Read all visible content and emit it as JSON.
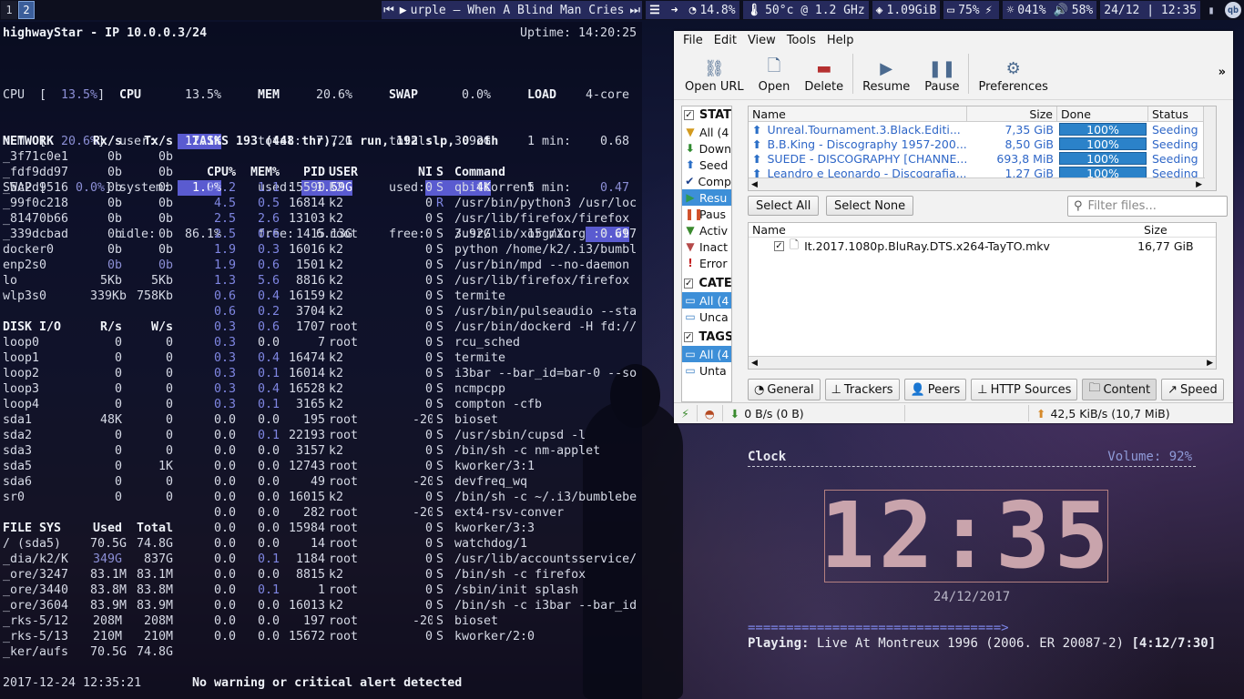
{
  "topbar": {
    "workspaces": [
      "1",
      "2"
    ],
    "media_prev": "⏮",
    "media_play": "▶",
    "media_title": "urple – When A Blind Man Cries",
    "media_next": "⏭",
    "cpu": "14.8%",
    "temp": "50°c @ 1.2 GHz",
    "mem": "1.09GiB",
    "battery": "75%",
    "brightness": "041%",
    "volume": "58%",
    "datetime": "24/12 | 12:35"
  },
  "glances": {
    "hostline": "highwayStar - IP 10.0.0.3/24",
    "uptime": "Uptime: 14:20:25",
    "quick": [
      {
        "label": "CPU",
        "val": "13.5%"
      },
      {
        "label": "MEM",
        "val": "20.6%"
      },
      {
        "label": "SWAP",
        "val": "0.0%"
      }
    ],
    "cpu": {
      "title": "CPU",
      "total": "13.5%",
      "rows": [
        [
          "user:",
          "12.1%"
        ],
        [
          "system:",
          "1.0%"
        ],
        [
          "idle:",
          "86.1%"
        ]
      ]
    },
    "mem": {
      "title": "MEM",
      "total": "20.6%",
      "rows": [
        [
          "total:",
          "7.72G"
        ],
        [
          "used:",
          "1.59G"
        ],
        [
          "free:",
          "6.13G"
        ]
      ]
    },
    "swap": {
      "title": "SWAP",
      "total": "0.0%",
      "rows": [
        [
          "total:",
          "3.92G"
        ],
        [
          "used:",
          "4K"
        ],
        [
          "free:",
          "3.92G"
        ]
      ]
    },
    "load": {
      "title": "LOAD",
      "cores": "4-core",
      "rows": [
        [
          "1 min:",
          "0.68"
        ],
        [
          "5 min:",
          "0.47"
        ],
        [
          "15 min:",
          "0.69"
        ]
      ]
    },
    "network": {
      "headers": [
        "NETWORK",
        "Rx/s",
        "Tx/s"
      ],
      "rows": [
        [
          "_3f71c0e1",
          "0b",
          "0b"
        ],
        [
          "_fdf9dd97",
          "0b",
          "0b"
        ],
        [
          "_5c2d9516",
          "0b",
          "0b"
        ],
        [
          "_99f0c218",
          "0b",
          "0b"
        ],
        [
          "_81470b66",
          "0b",
          "0b"
        ],
        [
          "_339dcbad",
          "0b",
          "0b"
        ],
        [
          "docker0",
          "0b",
          "0b"
        ],
        [
          "enp2s0",
          "0b",
          "0b"
        ],
        [
          "lo",
          "5Kb",
          "5Kb"
        ],
        [
          "wlp3s0",
          "339Kb",
          "758Kb"
        ]
      ]
    },
    "diskio": {
      "headers": [
        "DISK I/O",
        "R/s",
        "W/s"
      ],
      "rows": [
        [
          "loop0",
          "0",
          "0"
        ],
        [
          "loop1",
          "0",
          "0"
        ],
        [
          "loop2",
          "0",
          "0"
        ],
        [
          "loop3",
          "0",
          "0"
        ],
        [
          "loop4",
          "0",
          "0"
        ],
        [
          "sda1",
          "48K",
          "0"
        ],
        [
          "sda2",
          "0",
          "0"
        ],
        [
          "sda3",
          "0",
          "0"
        ],
        [
          "sda5",
          "0",
          "1K"
        ],
        [
          "sda6",
          "0",
          "0"
        ],
        [
          "sr0",
          "0",
          "0"
        ]
      ]
    },
    "filesys": {
      "headers": [
        "FILE SYS",
        "Used",
        "Total"
      ],
      "rows": [
        [
          "/ (sda5)",
          "70.5G",
          "74.8G"
        ],
        [
          "_dia/k2/K",
          "349G",
          "837G"
        ],
        [
          "_ore/3247",
          "83.1M",
          "83.1M"
        ],
        [
          "_ore/3440",
          "83.8M",
          "83.8M"
        ],
        [
          "_ore/3604",
          "83.9M",
          "83.9M"
        ],
        [
          "_rks-5/12",
          "208M",
          "208M"
        ],
        [
          "_rks-5/13",
          "210M",
          "210M"
        ],
        [
          "_ker/aufs",
          "70.5G",
          "74.8G"
        ]
      ]
    },
    "tasks_line": "TASKS 193 (448 thr), 1 run, 192 slp, 0 oth",
    "proc_headers": [
      "CPU%",
      "MEM%",
      "PID",
      "USER",
      "NI",
      "S",
      "Command"
    ],
    "procs": [
      [
        "37.2",
        "1.1",
        "15590",
        "k2",
        "0",
        "S",
        "qbittorrent"
      ],
      [
        "4.5",
        "0.5",
        "16814",
        "k2",
        "0",
        "R",
        "/usr/bin/python3 /usr/loc"
      ],
      [
        "2.5",
        "2.6",
        "13103",
        "k2",
        "0",
        "S",
        "/usr/lib/firefox/firefox"
      ],
      [
        "2.5",
        "0.6",
        "1415",
        "root",
        "0",
        "S",
        "/usr/lib/xorg/Xorg :0 vt7"
      ],
      [
        "1.9",
        "0.3",
        "16016",
        "k2",
        "0",
        "S",
        "python /home/k2/.i3/bumbl"
      ],
      [
        "1.9",
        "0.6",
        "1501",
        "k2",
        "0",
        "S",
        "/usr/bin/mpd --no-daemon"
      ],
      [
        "1.3",
        "5.6",
        "8816",
        "k2",
        "0",
        "S",
        "/usr/lib/firefox/firefox"
      ],
      [
        "0.6",
        "0.4",
        "16159",
        "k2",
        "0",
        "S",
        "termite"
      ],
      [
        "0.6",
        "0.2",
        "3704",
        "k2",
        "0",
        "S",
        "/usr/bin/pulseaudio --sta"
      ],
      [
        "0.3",
        "0.6",
        "1707",
        "root",
        "0",
        "S",
        "/usr/bin/dockerd -H fd://"
      ],
      [
        "0.3",
        "0.0",
        "7",
        "root",
        "0",
        "S",
        "rcu_sched"
      ],
      [
        "0.3",
        "0.4",
        "16474",
        "k2",
        "0",
        "S",
        "termite"
      ],
      [
        "0.3",
        "0.1",
        "16014",
        "k2",
        "0",
        "S",
        "i3bar --bar_id=bar-0 --so"
      ],
      [
        "0.3",
        "0.4",
        "16528",
        "k2",
        "0",
        "S",
        "ncmpcpp"
      ],
      [
        "0.3",
        "0.1",
        "3165",
        "k2",
        "0",
        "S",
        "compton -cfb"
      ],
      [
        "0.0",
        "0.0",
        "195",
        "root",
        "-20",
        "S",
        "bioset"
      ],
      [
        "0.0",
        "0.1",
        "22193",
        "root",
        "0",
        "S",
        "/usr/sbin/cupsd -l"
      ],
      [
        "0.0",
        "0.0",
        "3157",
        "k2",
        "0",
        "S",
        "/bin/sh -c nm-applet"
      ],
      [
        "0.0",
        "0.0",
        "12743",
        "root",
        "0",
        "S",
        "kworker/3:1"
      ],
      [
        "0.0",
        "0.0",
        "49",
        "root",
        "-20",
        "S",
        "devfreq_wq"
      ],
      [
        "0.0",
        "0.0",
        "16015",
        "k2",
        "0",
        "S",
        "/bin/sh -c ~/.i3/bumblebe"
      ],
      [
        "0.0",
        "0.0",
        "282",
        "root",
        "-20",
        "S",
        "ext4-rsv-conver"
      ],
      [
        "0.0",
        "0.0",
        "15984",
        "root",
        "0",
        "S",
        "kworker/3:3"
      ],
      [
        "0.0",
        "0.0",
        "14",
        "root",
        "0",
        "S",
        "watchdog/1"
      ],
      [
        "0.0",
        "0.1",
        "1184",
        "root",
        "0",
        "S",
        "/usr/lib/accountsservice/"
      ],
      [
        "0.0",
        "0.0",
        "8815",
        "k2",
        "0",
        "S",
        "/bin/sh -c firefox"
      ],
      [
        "0.0",
        "0.1",
        "1",
        "root",
        "0",
        "S",
        "/sbin/init splash"
      ],
      [
        "0.0",
        "0.0",
        "16013",
        "k2",
        "0",
        "S",
        "/bin/sh -c i3bar --bar_id"
      ],
      [
        "0.0",
        "0.0",
        "197",
        "root",
        "-20",
        "S",
        "bioset"
      ],
      [
        "0.0",
        "0.0",
        "15672",
        "root",
        "0",
        "S",
        "kworker/2:0"
      ]
    ],
    "footer_time": "2017-12-24 12:35:21",
    "footer_alert": "No warning or critical alert detected"
  },
  "qbittorrent": {
    "menu": [
      "File",
      "Edit",
      "View",
      "Tools",
      "Help"
    ],
    "toolbar": [
      {
        "label": "Open URL",
        "icon": "link-add-icon"
      },
      {
        "label": "Open",
        "icon": "file-open-icon"
      },
      {
        "label": "Delete",
        "icon": "delete-icon"
      },
      {
        "label": "Resume",
        "icon": "play-icon"
      },
      {
        "label": "Pause",
        "icon": "pause-icon"
      },
      {
        "label": "Preferences",
        "icon": "gear-icon"
      }
    ],
    "toolbar_more": "»",
    "status_header": "STAT",
    "status_items": [
      "All (4",
      "Down",
      "Seed",
      "Comp",
      "Resu",
      "Paus",
      "Activ",
      "Inact",
      "Error"
    ],
    "status_selected_index": 4,
    "category_header": "CATE",
    "category_items": [
      "All (4",
      "Unca"
    ],
    "tags_header": "TAGS",
    "tags_items": [
      "All (4",
      "Unta"
    ],
    "columns": [
      "Name",
      "Size",
      "Done",
      "Status"
    ],
    "torrents": [
      {
        "name": "Unreal.Tournament.3.Black.Editi...",
        "size": "7,35 GiB",
        "done": "100%",
        "status": "Seeding"
      },
      {
        "name": "B.B.King - Discography 1957-200...",
        "size": "8,50 GiB",
        "done": "100%",
        "status": "Seeding"
      },
      {
        "name": "SUEDE - DISCOGRAPHY [CHANNE...",
        "size": "693,8 MiB",
        "done": "100%",
        "status": "Seeding"
      },
      {
        "name": "Leandro e Leonardo - Discografia...",
        "size": "1,27 GiB",
        "done": "100%",
        "status": "Seeding"
      }
    ],
    "select_all": "Select All",
    "select_none": "Select None",
    "filter_placeholder": "Filter files...",
    "content_columns": [
      "Name",
      "Size"
    ],
    "content_files": [
      {
        "name": "It.2017.1080p.BluRay.DTS.x264-TayTO.mkv",
        "size": "16,77 GiB"
      }
    ],
    "tabs": [
      "General",
      "Trackers",
      "Peers",
      "HTTP Sources",
      "Content",
      "Speed"
    ],
    "selected_tab": "Content",
    "download_speed": "0 B/s (0 B)",
    "upload_speed": "42,5 KiB/s (10,7 MiB)"
  },
  "clock": {
    "title": "Clock",
    "volume": "Volume: 92%",
    "time": "12:35",
    "date": "24/12/2017",
    "progress": "=================================>",
    "playing_label": "Playing:",
    "playing_track": " Live At Montreux 1996 (2006. ER 20087-2) ",
    "playing_time": "[4:12/7:30]"
  }
}
